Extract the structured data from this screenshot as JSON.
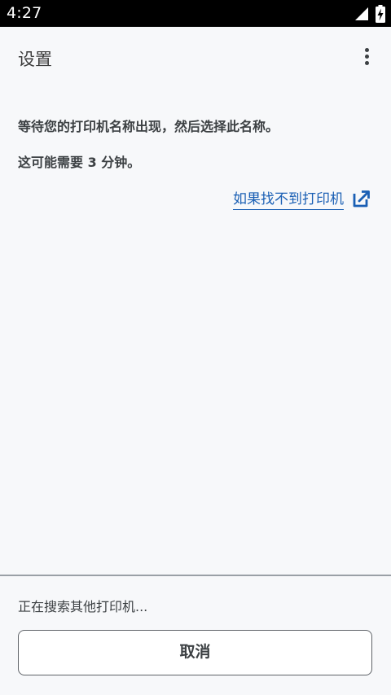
{
  "status_bar": {
    "time": "4:27"
  },
  "app_bar": {
    "title": "设置"
  },
  "content": {
    "instruction_1": "等待您的打印机名称出现，然后选择此名称。",
    "instruction_2": "这可能需要 3 分钟。",
    "help_link": "如果找不到打印机"
  },
  "bottom": {
    "status_text": "正在搜索其他打印机...",
    "cancel_label": "取消"
  },
  "colors": {
    "background": "#f7f8fa",
    "link": "#1a5fb4",
    "status_bar": "#000000"
  }
}
